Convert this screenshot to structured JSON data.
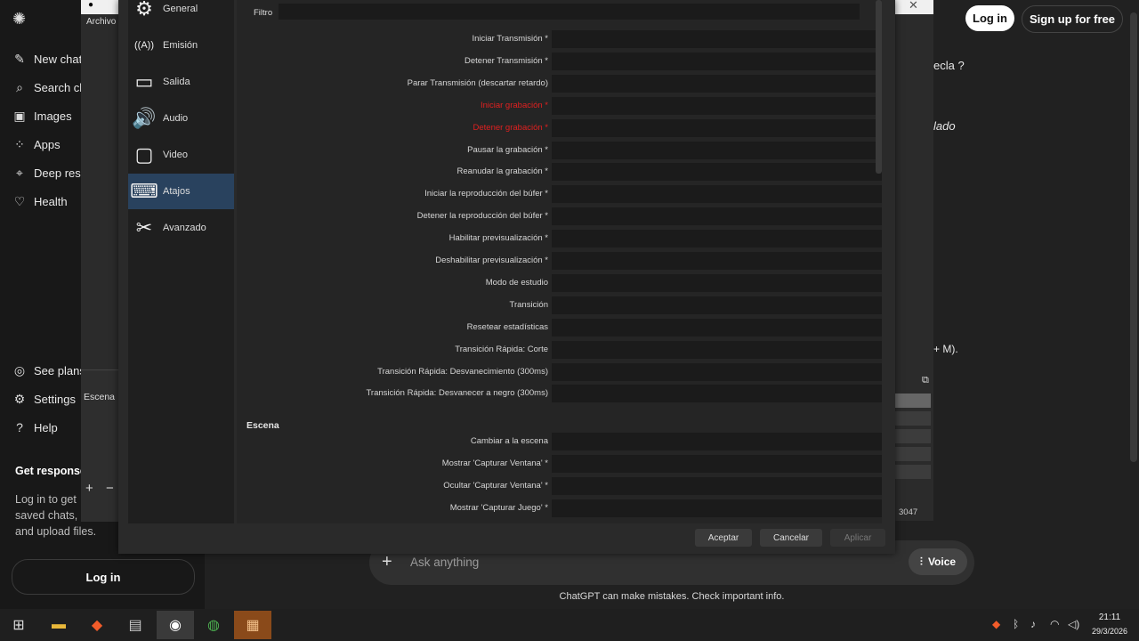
{
  "chatgpt": {
    "sidebar_items": [
      {
        "icon": "new-chat-icon",
        "glyph": "✎",
        "label": "New chat"
      },
      {
        "icon": "search-icon",
        "glyph": "⌕",
        "label": "Search ch"
      },
      {
        "icon": "images-icon",
        "glyph": "▣",
        "label": "Images"
      },
      {
        "icon": "apps-icon",
        "glyph": "⁘",
        "label": "Apps"
      },
      {
        "icon": "deep-research-icon",
        "glyph": "⌖",
        "label": "Deep rese"
      },
      {
        "icon": "health-icon",
        "glyph": "♡",
        "label": "Health"
      }
    ],
    "bottom_items": [
      {
        "icon": "see-plans-icon",
        "glyph": "◎",
        "label": "See plans"
      },
      {
        "icon": "settings-icon",
        "glyph": "⚙",
        "label": "Settings"
      },
      {
        "icon": "help-icon",
        "glyph": "?",
        "label": "Help"
      }
    ],
    "promo_title": "Get response",
    "promo_body": [
      "Log in to get",
      "saved chats, p",
      "and upload files."
    ],
    "login_sidebar": "Log in",
    "login_top": "Log in",
    "signup_top": "Sign up for free",
    "partial_text_1": "ecla ?",
    "partial_text_2": "lado",
    "partial_text_3": "+ M).",
    "input_placeholder": "Ask anything",
    "voice_label": "Voice",
    "disclaimer": "ChatGPT can make mistakes. Check important info."
  },
  "obs": {
    "menu_archivo": "Archivo",
    "scene_dock_title": "Escena",
    "status_number": "3047",
    "categories": [
      {
        "label": "General",
        "glyph": "⚙"
      },
      {
        "label": "Emisión",
        "glyph": "((A))"
      },
      {
        "label": "Salida",
        "glyph": "▭"
      },
      {
        "label": "Audio",
        "glyph": "🔊"
      },
      {
        "label": "Video",
        "glyph": "▢"
      },
      {
        "label": "Atajos",
        "glyph": "⌨"
      },
      {
        "label": "Avanzado",
        "glyph": "✂"
      }
    ],
    "selected_category": "Atajos",
    "filter_label": "Filtro",
    "hotkeys": [
      {
        "label": "Iniciar Transmisión *",
        "red": false
      },
      {
        "label": "Detener Transmisión *",
        "red": false
      },
      {
        "label": "Parar Transmisión (descartar retardo)",
        "red": false
      },
      {
        "label": "Iniciar grabación *",
        "red": true
      },
      {
        "label": "Detener grabación *",
        "red": true
      },
      {
        "label": "Pausar la grabación *",
        "red": false
      },
      {
        "label": "Reanudar la grabación *",
        "red": false
      },
      {
        "label": "Iniciar la reproducción del búfer *",
        "red": false
      },
      {
        "label": "Detener la reproducción del búfer *",
        "red": false
      },
      {
        "label": "Habilitar previsualización *",
        "red": false
      },
      {
        "label": "Deshabilitar previsualización *",
        "red": false
      },
      {
        "label": "Modo de estudio",
        "red": false
      },
      {
        "label": "Transición",
        "red": false
      },
      {
        "label": "Resetear estadísticas",
        "red": false
      },
      {
        "label": "Transición Rápida: Corte",
        "red": false
      },
      {
        "label": "Transición Rápida: Desvanecimiento (300ms)",
        "red": false
      },
      {
        "label": "Transición Rápida: Desvanecer a negro (300ms)",
        "red": false
      }
    ],
    "section_escena": "Escena",
    "scene_hotkeys": [
      {
        "label": "Cambiar a la escena",
        "red": false
      },
      {
        "label": "Mostrar 'Capturar Ventana' *",
        "red": false
      },
      {
        "label": "Ocultar 'Capturar Ventana' *",
        "red": false
      },
      {
        "label": "Mostrar 'Capturar Juego' *",
        "red": false
      }
    ],
    "row_buttons": [
      {
        "name": "revert-icon",
        "glyph": "↺"
      },
      {
        "name": "trash-icon",
        "glyph": "🗑"
      },
      {
        "name": "add-icon",
        "glyph": "+"
      },
      {
        "name": "remove-icon",
        "glyph": "−"
      }
    ],
    "btn_accept": "Aceptar",
    "btn_cancel": "Cancelar",
    "btn_apply": "Aplicar"
  },
  "taskbar": {
    "time": "21:11",
    "date": "29/3/2026"
  }
}
